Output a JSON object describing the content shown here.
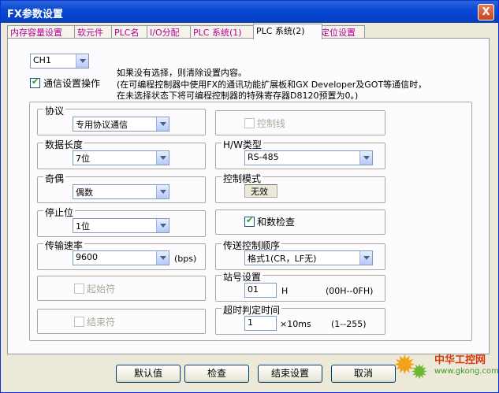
{
  "window": {
    "title": "FX参数设置",
    "close_label": "X"
  },
  "tabs": [
    {
      "label": "内存容量设置"
    },
    {
      "label": "软元件"
    },
    {
      "label": "PLC名"
    },
    {
      "label": "I/O分配"
    },
    {
      "label": "PLC 系统(1)"
    },
    {
      "label": "PLC 系统(2)"
    },
    {
      "label": "定位设置"
    }
  ],
  "channel": {
    "value": "CH1"
  },
  "comm_setting": {
    "label": "通信设置操作",
    "checked": true
  },
  "notes": [
    "如果没有选择，则清除设置内容。",
    "(在可编程控制器中使用FX的通讯功能扩展板和GX Developer及GOT等通信时，",
    "在未选择状态下将可编程控制器的特殊寄存器D8120预置为0。)"
  ],
  "left": {
    "protocol": {
      "label": "协议",
      "value": "专用协议通信"
    },
    "data_length": {
      "label": "数据长度",
      "value": "7位"
    },
    "parity": {
      "label": "奇偶",
      "value": "偶数"
    },
    "stop_bit": {
      "label": "停止位",
      "value": "1位"
    },
    "baud_rate": {
      "label": "传输速率",
      "value": "9600",
      "unit": "(bps)"
    },
    "start_char": {
      "label": "起始符"
    },
    "end_char": {
      "label": "结束符"
    }
  },
  "right": {
    "control_line": {
      "label": "控制线"
    },
    "hw_type": {
      "label": "H/W类型",
      "value": "RS-485"
    },
    "control_mode": {
      "label": "控制模式",
      "value": "无效"
    },
    "checksum": {
      "label": "和数检查",
      "checked": true
    },
    "transmission_order": {
      "label": "传送控制顺序",
      "value": "格式1(CR，LF无)"
    },
    "station": {
      "label": "站号设置",
      "value": "01",
      "unit": "H",
      "range": "(00H--0FH)"
    },
    "timeout": {
      "label": "超时判定时间",
      "value": "1",
      "unit": "×10ms",
      "range": "(1--255)"
    }
  },
  "buttons": {
    "default": "默认值",
    "check": "检查",
    "finish": "结束设置",
    "cancel": "取消"
  },
  "watermark": {
    "line1": "中华工控网",
    "line2": "www.gkong.com"
  }
}
